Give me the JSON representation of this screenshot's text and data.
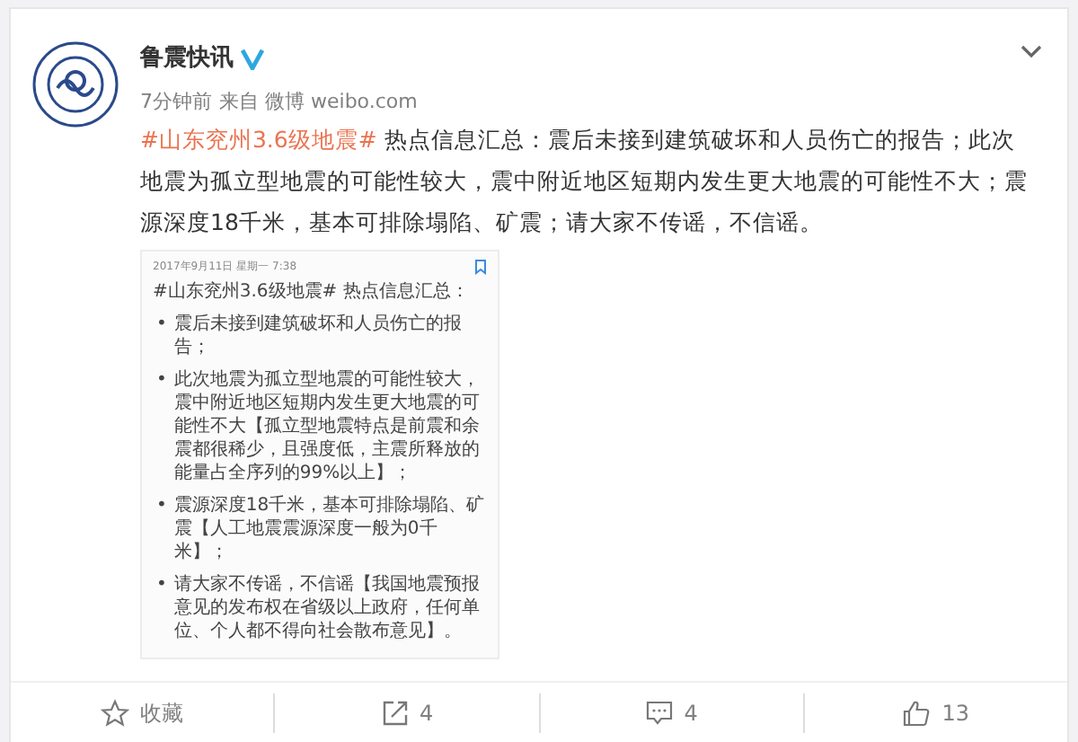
{
  "post": {
    "author": "鲁震快讯",
    "verified": true,
    "time": "7分钟前",
    "source": "来自 微博 weibo.com",
    "topic": "#山东兖州3.6级地震#",
    "text": " 热点信息汇总：震后未接到建筑破坏和人员伤亡的报告；此次地震为孤立型地震的可能性较大，震中附近地区短期内发生更大地震的可能性不大；震源深度18千米，基本可排除塌陷、矿震；请大家不传谣，不信谣。",
    "image": {
      "date": "2017年9月11日 星期一 7:38",
      "heading": "#山东兖州3.6级地震# 热点信息汇总：",
      "bullets": [
        {
          "marker": "•",
          "text": "震后未接到建筑破坏和人员伤亡的报告；"
        },
        {
          "marker": "•",
          "text": "此次地震为孤立型地震的可能性较大，震中附近地区短期内发生更大地震的可能性不大【孤立型地震特点是前震和余震都很稀少，且强度低，主震所释放的能量占全序列的99%以上】；"
        },
        {
          "marker": "•",
          "text": "震源深度18千米，基本可排除塌陷、矿震【人工地震震源深度一般为0千米】；"
        },
        {
          "marker": "•",
          "text": "请大家不传谣，不信谣【我国地震预报意见的发布权在省级以上政府，任何单位、个人都不得向社会散布意见】。"
        }
      ]
    }
  },
  "actions": [
    {
      "kind": "favorite",
      "label": "收藏"
    },
    {
      "kind": "repost",
      "label": "4"
    },
    {
      "kind": "comment",
      "label": "4"
    },
    {
      "kind": "like",
      "label": "13"
    }
  ]
}
